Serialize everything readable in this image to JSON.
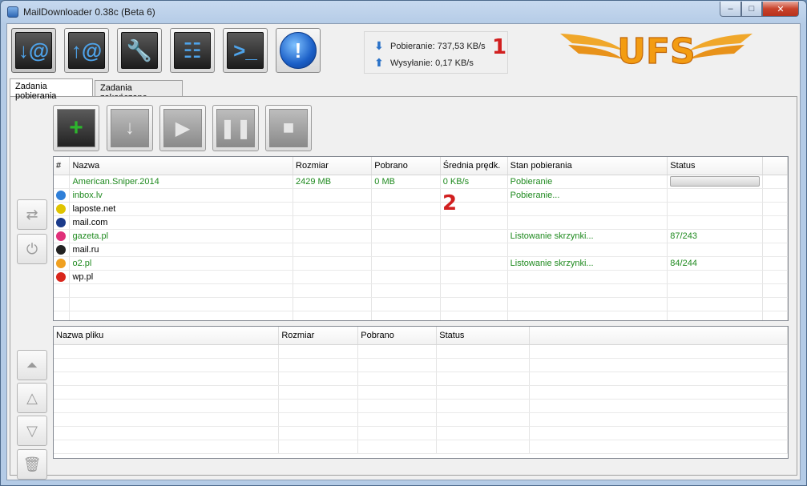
{
  "window": {
    "title": "MailDownloader 0.38c (Beta 6)",
    "controls": {
      "minimize": "–",
      "maximize": "□",
      "close": "✕"
    }
  },
  "toolbar": {
    "buttons": [
      {
        "icon": "download-mail-icon",
        "glyph": "↓@"
      },
      {
        "icon": "upload-mail-icon",
        "glyph": "↑@"
      },
      {
        "icon": "wrench-icon",
        "glyph": "🔧"
      },
      {
        "icon": "sliders-icon",
        "glyph": "☷"
      },
      {
        "icon": "console-icon",
        "glyph": ">_"
      },
      {
        "icon": "info-icon",
        "glyph": "!"
      }
    ]
  },
  "speed": {
    "download": "Pobieranie: 737,53 KB/s",
    "upload": "Wysyłanie: 0,17 KB/s"
  },
  "annotations": {
    "mark1": "1",
    "mark2": "2"
  },
  "logo": {
    "text": "UFS",
    "color": "#f39c12"
  },
  "tabs": [
    {
      "label": "Zadania pobierania",
      "active": true
    },
    {
      "label": "Zadania zakończone",
      "active": false
    }
  ],
  "actions": [
    {
      "icon": "add-task-icon",
      "glyph": "+",
      "enabled": true
    },
    {
      "icon": "download-icon",
      "glyph": "↓",
      "enabled": false
    },
    {
      "icon": "play-icon",
      "glyph": "▶",
      "enabled": false
    },
    {
      "icon": "pause-icon",
      "glyph": "❚❚",
      "enabled": false
    },
    {
      "icon": "stop-icon",
      "glyph": "■",
      "enabled": false
    }
  ],
  "side_top": [
    {
      "icon": "swap-icon",
      "glyph": "⇄"
    },
    {
      "icon": "power-icon",
      "glyph": "⏻"
    }
  ],
  "side_bottom": [
    {
      "icon": "move-top-icon",
      "glyph": "⏶"
    },
    {
      "icon": "move-up-icon",
      "glyph": "△"
    },
    {
      "icon": "move-down-icon",
      "glyph": "▽"
    },
    {
      "icon": "trash-icon",
      "glyph": "🗑"
    }
  ],
  "tasks": {
    "columns": [
      "#",
      "Nazwa",
      "Rozmiar",
      "Pobrano",
      "Średnia prędk.",
      "Stan pobierania",
      "Status"
    ],
    "rows": [
      {
        "icon": "",
        "name": "American.Sniper.2014",
        "size": "2429 MB",
        "downloaded": "0 MB",
        "speed": "0 KB/s",
        "state": "Pobieranie",
        "status": "",
        "progress": 0,
        "green": true
      },
      {
        "icon": "#2f7fd8",
        "name": "inbox.lv",
        "size": "",
        "downloaded": "",
        "speed": "",
        "state": "Pobieranie...",
        "status": "",
        "green": true
      },
      {
        "icon": "#e0c400",
        "name": "laposte.net",
        "size": "",
        "downloaded": "",
        "speed": "",
        "state": "",
        "status": "",
        "green": false
      },
      {
        "icon": "#1a3a8a",
        "name": "mail.com",
        "size": "",
        "downloaded": "",
        "speed": "",
        "state": "",
        "status": "",
        "green": false
      },
      {
        "icon": "#e0307a",
        "name": "gazeta.pl",
        "size": "",
        "downloaded": "",
        "speed": "",
        "state": "Listowanie skrzynki...",
        "status": "87/243",
        "green": true
      },
      {
        "icon": "#222222",
        "name": "mail.ru",
        "size": "",
        "downloaded": "",
        "speed": "",
        "state": "",
        "status": "",
        "green": false
      },
      {
        "icon": "#f0a020",
        "name": "o2.pl",
        "size": "",
        "downloaded": "",
        "speed": "",
        "state": "Listowanie skrzynki...",
        "status": "84/244",
        "green": true
      },
      {
        "icon": "#d9261c",
        "name": "wp.pl",
        "size": "",
        "downloaded": "",
        "speed": "",
        "state": "",
        "status": "",
        "green": false
      }
    ]
  },
  "files": {
    "columns": [
      "Nazwa pliku",
      "Rozmiar",
      "Pobrano",
      "Status"
    ]
  }
}
